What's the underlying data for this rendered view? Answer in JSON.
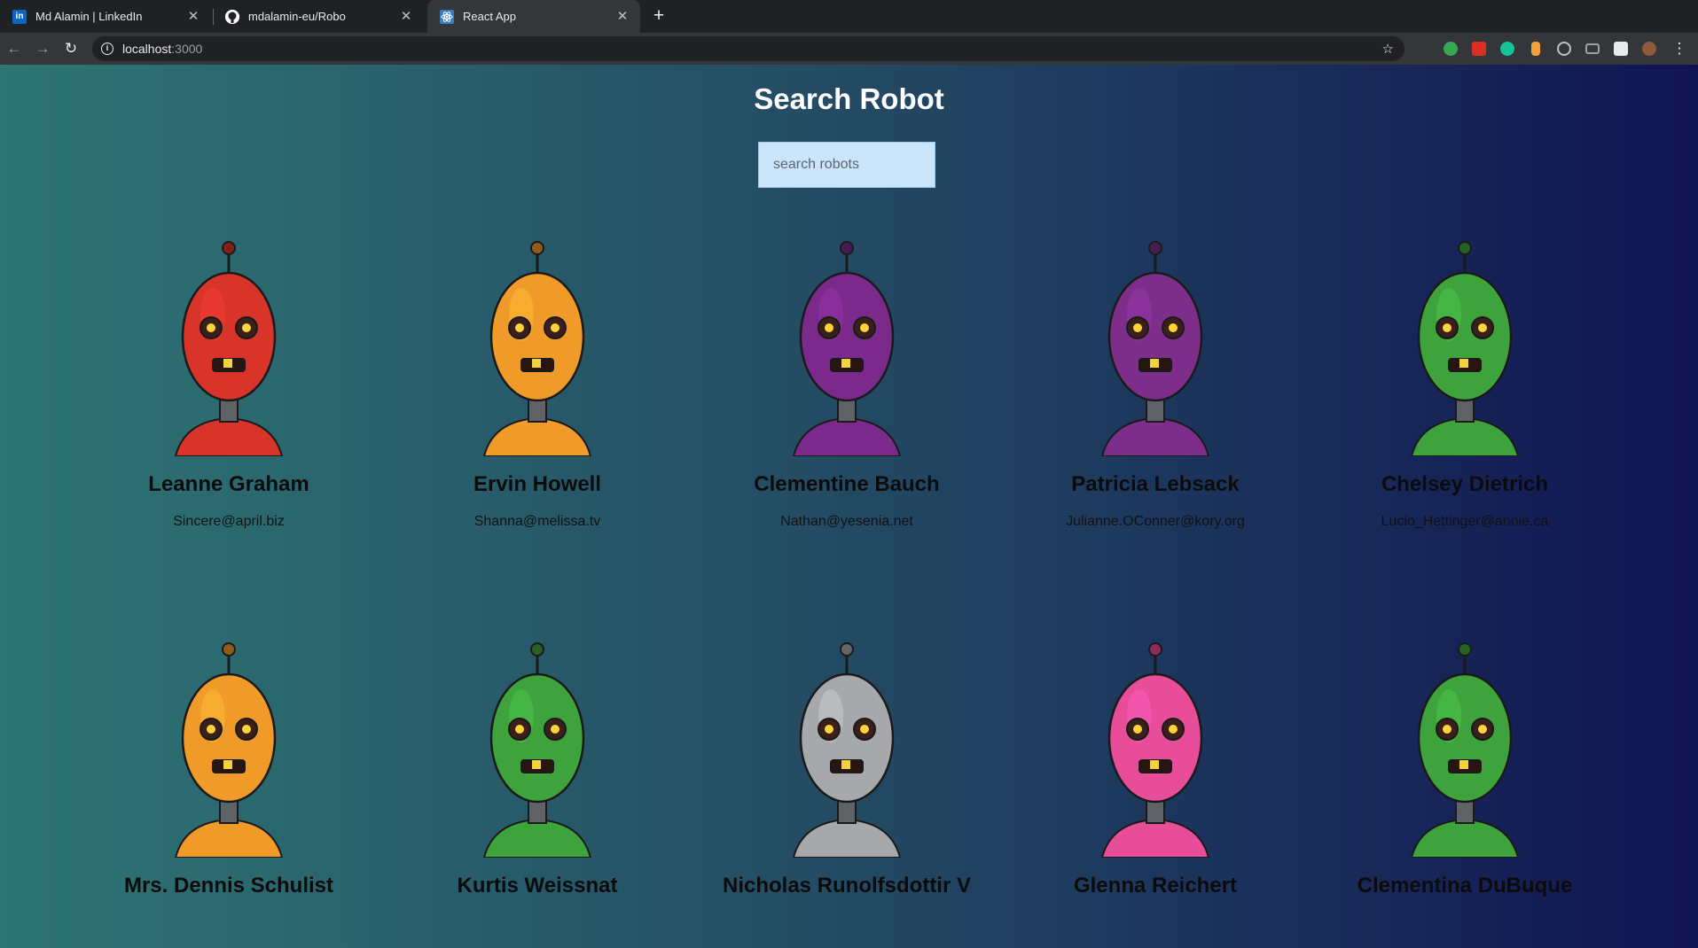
{
  "browser": {
    "tabs": [
      {
        "title": "Md Alamin | LinkedIn",
        "favicon": "linkedin-icon",
        "color": "#0a66c2"
      },
      {
        "title": "mdalamin-eu/Robo",
        "favicon": "github-icon",
        "color": "#ffffff"
      },
      {
        "title": "React App",
        "favicon": "react-icon",
        "color": "#61dafb"
      }
    ],
    "url_host": "localhost",
    "url_port": ":3000"
  },
  "app": {
    "title": "Search Robot",
    "search_placeholder": "search robots"
  },
  "robots": [
    {
      "name": "Leanne Graham",
      "email": "Sincere@april.biz",
      "color": "#d8342a"
    },
    {
      "name": "Ervin Howell",
      "email": "Shanna@melissa.tv",
      "color": "#f09a2a"
    },
    {
      "name": "Clementine Bauch",
      "email": "Nathan@yesenia.net",
      "color": "#7b2a8c"
    },
    {
      "name": "Patricia Lebsack",
      "email": "Julianne.OConner@kory.org",
      "color": "#7d2e8a"
    },
    {
      "name": "Chelsey Dietrich",
      "email": "Lucio_Hettinger@annie.ca",
      "color": "#3ea33c"
    },
    {
      "name": "Mrs. Dennis Schulist",
      "email": "",
      "color": "#f09a2a"
    },
    {
      "name": "Kurtis Weissnat",
      "email": "",
      "color": "#3ea33c"
    },
    {
      "name": "Nicholas Runolfsdottir V",
      "email": "",
      "color": "#a6a8ab"
    },
    {
      "name": "Glenna Reichert",
      "email": "",
      "color": "#e84d9a"
    },
    {
      "name": "Clementina DuBuque",
      "email": "",
      "color": "#3ea33c"
    }
  ]
}
